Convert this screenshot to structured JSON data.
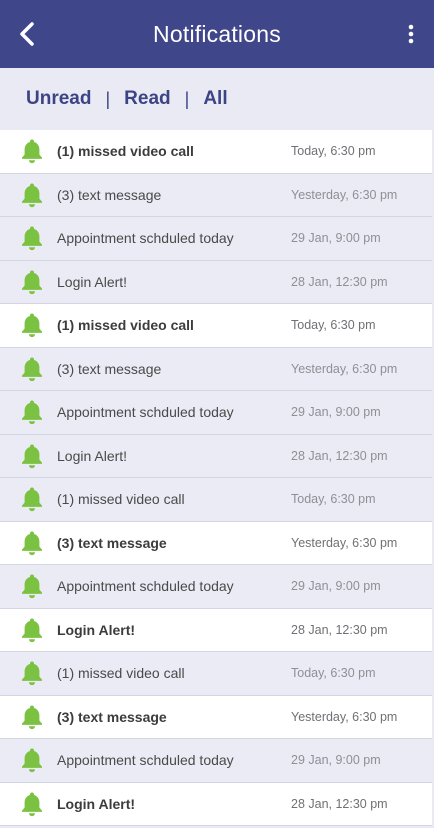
{
  "header": {
    "title": "Notifications",
    "back_icon": "chevron-left-icon",
    "more_icon": "more-vertical-icon"
  },
  "filters": {
    "tabs": [
      "Unread",
      "Read",
      "All"
    ],
    "separator": "|"
  },
  "colors": {
    "header_bg": "#3f4689",
    "accent": "#3d4486",
    "bell": "#7cc242",
    "unread_bg": "#ffffff",
    "read_bg": "#eaebf4"
  },
  "notifications": [
    {
      "text": "(1) missed video call",
      "time": "Today, 6:30 pm",
      "unread": true
    },
    {
      "text": "(3) text message",
      "time": "Yesterday, 6:30 pm",
      "unread": false
    },
    {
      "text": "Appointment schduled today",
      "time": "29 Jan, 9:00 pm",
      "unread": false
    },
    {
      "text": "Login Alert!",
      "time": "28 Jan, 12:30 pm",
      "unread": false
    },
    {
      "text": "(1) missed video call",
      "time": "Today, 6:30 pm",
      "unread": true
    },
    {
      "text": "(3) text message",
      "time": "Yesterday, 6:30 pm",
      "unread": false
    },
    {
      "text": "Appointment schduled today",
      "time": "29 Jan, 9:00 pm",
      "unread": false
    },
    {
      "text": "Login Alert!",
      "time": "28 Jan, 12:30 pm",
      "unread": false
    },
    {
      "text": "(1) missed video call",
      "time": "Today, 6:30 pm",
      "unread": false
    },
    {
      "text": "(3) text message",
      "time": "Yesterday, 6:30 pm",
      "unread": true
    },
    {
      "text": "Appointment schduled today",
      "time": "29 Jan, 9:00 pm",
      "unread": false
    },
    {
      "text": "Login Alert!",
      "time": "28 Jan, 12:30 pm",
      "unread": true
    },
    {
      "text": "(1) missed video call",
      "time": "Today, 6:30 pm",
      "unread": false
    },
    {
      "text": "(3) text message",
      "time": "Yesterday, 6:30 pm",
      "unread": true
    },
    {
      "text": "Appointment schduled today",
      "time": "29 Jan, 9:00 pm",
      "unread": false
    },
    {
      "text": "Login Alert!",
      "time": "28 Jan, 12:30 pm",
      "unread": true
    }
  ]
}
